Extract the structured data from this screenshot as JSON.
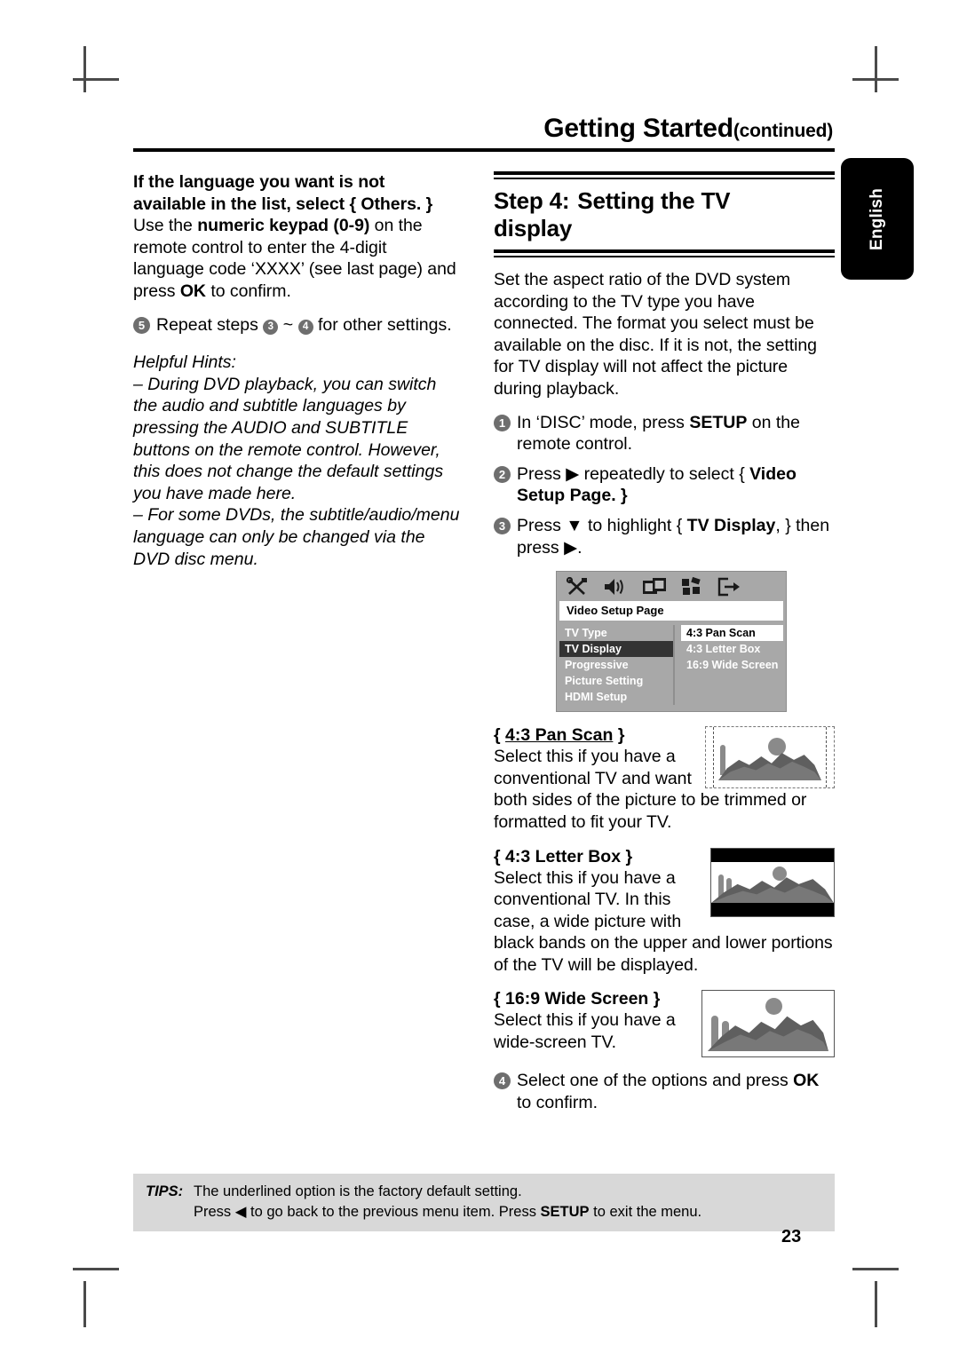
{
  "header": {
    "title": "Getting Started",
    "continued": "(continued)"
  },
  "lang_tab": {
    "label": "English"
  },
  "left_column": {
    "note_bold_line1": "If the language you want is not",
    "note_bold_line2": "available in the list, select { Others. }",
    "note_rest_1": "Use the ",
    "note_rest_bold_1": "numeric keypad (0-9)",
    "note_rest_2": " on the remote control to enter the 4-digit language code ‘XXXX’ (see last page) and press ",
    "note_rest_bold_2": "OK",
    "note_rest_3": " to confirm.",
    "step5_num": "5",
    "step5_pre": "Repeat steps ",
    "step5_a": "3",
    "step5_mid": " ~ ",
    "step5_b": "4",
    "step5_post": " for other settings.",
    "hints_title": "Helpful Hints:",
    "hint1": "– During DVD playback, you can switch the audio and subtitle languages by pressing the AUDIO and SUBTITLE buttons on the remote control.  However, this does not change the default settings you have made here.",
    "hint2": "– For some DVDs, the subtitle/audio/menu language can only be changed via the DVD disc menu."
  },
  "right_column": {
    "step_heading_1": "Step 4:",
    "step_heading_2": "Setting the TV",
    "step_heading_3": "display",
    "intro": "Set the aspect ratio of the DVD system according to the TV type you have connected. The format you select must be available on the disc.  If it is not, the setting for TV display will not affect the picture during playback.",
    "steps": [
      {
        "num": "1",
        "pre": "In ‘DISC’ mode, press ",
        "bold": "SETUP",
        "post": " on the remote control."
      },
      {
        "num": "2",
        "pre": "Press ▶ repeatedly to select { ",
        "bold": "Video Setup Page",
        "post": ". }"
      },
      {
        "num": "3",
        "pre": "Press ▼ to highlight { ",
        "bold": "TV Display",
        "post": ", } then press ▶."
      }
    ],
    "final_step": {
      "num": "4",
      "pre": "Select one of the options and press ",
      "bold": "OK",
      "post": " to confirm."
    }
  },
  "osd": {
    "icons": [
      "tools-icon",
      "speaker-icon",
      "film-strip-icon",
      "preference-icon",
      "exit-icon"
    ],
    "title": "Video Setup Page",
    "menu_items": [
      {
        "label": "TV Type",
        "selected": false
      },
      {
        "label": "TV Display",
        "selected": true
      },
      {
        "label": "Progressive",
        "selected": false
      },
      {
        "label": "Picture Setting",
        "selected": false
      },
      {
        "label": "HDMI Setup",
        "selected": false
      }
    ],
    "options": [
      {
        "label": "4:3 Pan Scan",
        "selected": true
      },
      {
        "label": "4:3 Letter Box",
        "selected": false
      },
      {
        "label": "16:9 Wide Screen",
        "selected": false
      }
    ],
    "colors": {
      "background": "#a8a8a8",
      "highlight_menu": "#333333",
      "highlight_option": "#ffffff",
      "titlebar": "#ffffff"
    }
  },
  "aspect_options": [
    {
      "brace_open": "{ ",
      "name": "4:3 Pan Scan",
      "brace_close": " }",
      "underlined": true,
      "description": "Select this if you have a conventional TV and want both sides of the picture to be trimmed or formatted to fit your TV.",
      "thumb": "pan-scan-thumbnail"
    },
    {
      "brace_open": "{ ",
      "name": "4:3 Letter Box",
      "brace_close": " }",
      "underlined": false,
      "description": "Select this if you have a conventional TV.  In this case, a wide picture with black bands on the upper and lower portions of the TV will be displayed.",
      "thumb": "letter-box-thumbnail"
    },
    {
      "brace_open": "{ ",
      "name": "16:9 Wide Screen",
      "brace_close": " }",
      "underlined": false,
      "description": "Select this if you have a wide-screen TV.",
      "thumb": "wide-screen-thumbnail"
    }
  ],
  "tips": {
    "label": "TIPS:",
    "line1": "The underlined option is the factory default setting.",
    "line2_pre": "Press ◀ to go back to the previous menu item.  Press ",
    "line2_bold": "SETUP",
    "line2_post": " to exit the menu."
  },
  "page_number": "23"
}
